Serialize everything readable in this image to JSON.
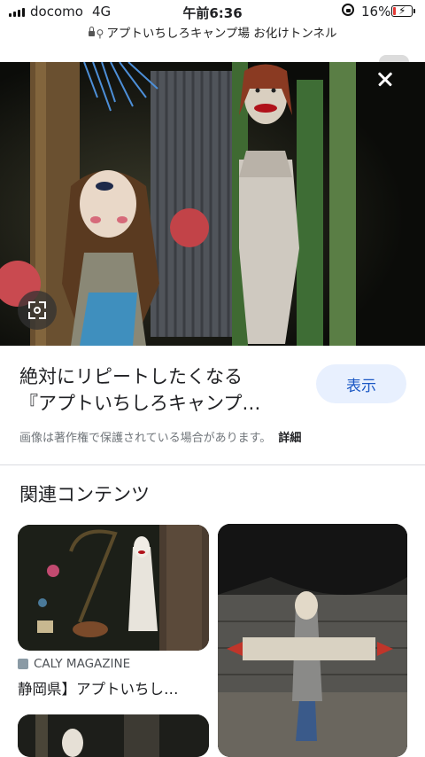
{
  "status_bar": {
    "carrier": "docomo",
    "network": "4G",
    "time": "午前6:36",
    "battery_percent": "16%",
    "battery_level": 0.16,
    "battery_color": "#e53935",
    "icons": [
      "signal-icon",
      "orientation-lock-icon",
      "battery-charging-icon"
    ]
  },
  "url_bar": {
    "text": "アプトいちしろキャンプ場 お化けトンネル",
    "icons": [
      "lock-icon",
      "search-icon"
    ]
  },
  "viewer": {
    "close_icon": "close-icon",
    "lens_icon": "lens-icon"
  },
  "result": {
    "title_line1": "絶対にリピートしたくなる",
    "title_line2": "『アプトいちしろキャンプ…",
    "show_button": "表示",
    "copyright_notice": "画像は著作権で保護されている場合があります。",
    "detail_link": "詳細"
  },
  "related": {
    "heading": "関連コンテンツ",
    "cards": [
      {
        "source": "CALY MAGAZINE",
        "title": "静岡県】アプトいちし…"
      }
    ]
  },
  "colors": {
    "accent": "#1a57c4",
    "button_bg": "#e8f0fe"
  }
}
